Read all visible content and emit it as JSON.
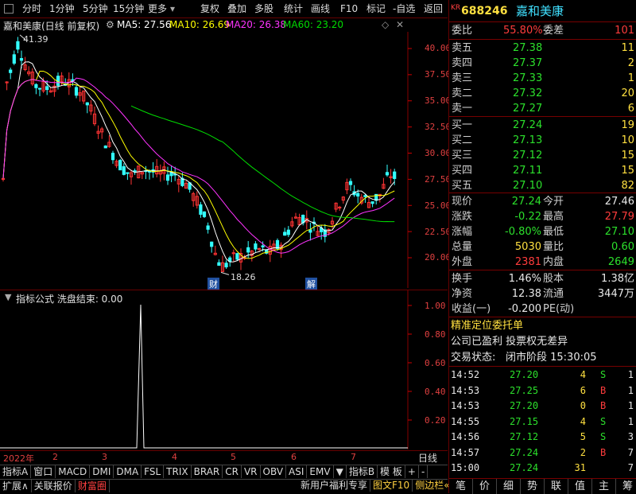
{
  "toolbar": {
    "items": [
      "分时",
      "1分钟",
      "5分钟",
      "15分钟",
      "更多",
      "复权",
      "叠加",
      "多股",
      "统计",
      "画线",
      "F10",
      "标记",
      "-自选",
      "返回"
    ]
  },
  "chart": {
    "title": "嘉和美康(日线 前复权)",
    "ma5_label": "MA5: 27.56",
    "ma10_label": "MA10: 26.69",
    "ma20_label": "MA20: 26.38",
    "ma60_label": "MA60: 23.20",
    "high_annot": "41.39",
    "low_annot": "18.26",
    "event_cai": "财",
    "event_jie": "解",
    "price_ticks": [
      "40.00",
      "37.50",
      "35.00",
      "32.50",
      "30.00",
      "27.50",
      "25.00",
      "22.50",
      "20.00"
    ],
    "colors": {
      "ma5": "#ffffff",
      "ma10": "#ffff00",
      "ma20": "#ff33ff",
      "ma60": "#00dd00",
      "up": "#ff3333",
      "down": "#33ffff"
    }
  },
  "indicator": {
    "title": "指标公式 洗盘结束: 0.00",
    "ticks": [
      "1.00",
      "0.80",
      "0.60",
      "0.40",
      "0.20"
    ]
  },
  "time_axis": {
    "labels": [
      "2022年",
      "2",
      "3",
      "4",
      "5",
      "6",
      "7"
    ],
    "right_label": "日线"
  },
  "tabs_row1": [
    "指标A",
    "窗口",
    "MACD",
    "DMI",
    "DMA",
    "FSL",
    "TRIX",
    "BRAR",
    "CR",
    "VR",
    "OBV",
    "ASI",
    "EMV",
    "▼",
    "指标B",
    "模 板",
    "+",
    "-"
  ],
  "tabs_row2_left": [
    "扩展∧",
    "关联报价",
    "财富圈"
  ],
  "tabs_row2_right": [
    "新用户福利专享",
    "图文F10",
    "侧边栏«"
  ],
  "panel": {
    "code_prefix": "KR",
    "code": "688246",
    "name": "嘉和美康",
    "weibi_label": "委比",
    "weibi_value": "55.80%",
    "weicha_label": "委差",
    "weicha_value": "101",
    "asks": [
      {
        "label": "卖五",
        "price": "27.38",
        "vol": "11"
      },
      {
        "label": "卖四",
        "price": "27.37",
        "vol": "2"
      },
      {
        "label": "卖三",
        "price": "27.33",
        "vol": "1"
      },
      {
        "label": "卖二",
        "price": "27.32",
        "vol": "20"
      },
      {
        "label": "卖一",
        "price": "27.27",
        "vol": "6"
      }
    ],
    "bids": [
      {
        "label": "买一",
        "price": "27.24",
        "vol": "19"
      },
      {
        "label": "买二",
        "price": "27.13",
        "vol": "10"
      },
      {
        "label": "买三",
        "price": "27.12",
        "vol": "15"
      },
      {
        "label": "买四",
        "price": "27.11",
        "vol": "15"
      },
      {
        "label": "买五",
        "price": "27.10",
        "vol": "82"
      }
    ],
    "stats": [
      {
        "l1": "现价",
        "v1": "27.24",
        "c1": "grn",
        "l2": "今开",
        "v2": "27.46",
        "c2": "wht"
      },
      {
        "l1": "涨跌",
        "v1": "-0.22",
        "c1": "grn",
        "l2": "最高",
        "v2": "27.79",
        "c2": "red"
      },
      {
        "l1": "涨幅",
        "v1": "-0.80%",
        "c1": "grn",
        "l2": "最低",
        "v2": "27.10",
        "c2": "grn"
      },
      {
        "l1": "总量",
        "v1": "5030",
        "c1": "yel",
        "l2": "量比",
        "v2": "0.60",
        "c2": "grn"
      },
      {
        "l1": "外盘",
        "v1": "2381",
        "c1": "red",
        "l2": "内盘",
        "v2": "2649",
        "c2": "grn"
      }
    ],
    "stats2": [
      {
        "l1": "换手",
        "v1": "1.46%",
        "l2": "股本",
        "v2": "1.38亿"
      },
      {
        "l1": "净资",
        "v1": "12.38",
        "l2": "流通",
        "v2": "3447万"
      },
      {
        "l1": "收益(一)",
        "v1": "-0.200",
        "l2": "PE(动)",
        "v2": ""
      }
    ],
    "notice1": "精准定位委托单",
    "notice2": "公司已盈利 投票权无差异",
    "trade_status_label": "交易状态:",
    "trade_status_value": "闭市阶段 15:30:05",
    "trades": [
      {
        "time": "14:52",
        "price": "27.20",
        "vol": "4",
        "bs": "S",
        "n": "1"
      },
      {
        "time": "14:53",
        "price": "27.25",
        "vol": "6",
        "bs": "B",
        "n": "1"
      },
      {
        "time": "14:53",
        "price": "27.20",
        "vol": "0",
        "bs": "B",
        "n": "1"
      },
      {
        "time": "14:55",
        "price": "27.15",
        "vol": "4",
        "bs": "S",
        "n": "1"
      },
      {
        "time": "14:56",
        "price": "27.12",
        "vol": "5",
        "bs": "S",
        "n": "3"
      },
      {
        "time": "14:57",
        "price": "27.24",
        "vol": "2",
        "bs": "B",
        "n": "7"
      },
      {
        "time": "15:00",
        "price": "27.24",
        "vol": "31",
        "bs": "",
        "n": "7"
      }
    ],
    "bottom_tabs": [
      "笔",
      "价",
      "细",
      "势",
      "联",
      "值",
      "主",
      "筹"
    ]
  }
}
